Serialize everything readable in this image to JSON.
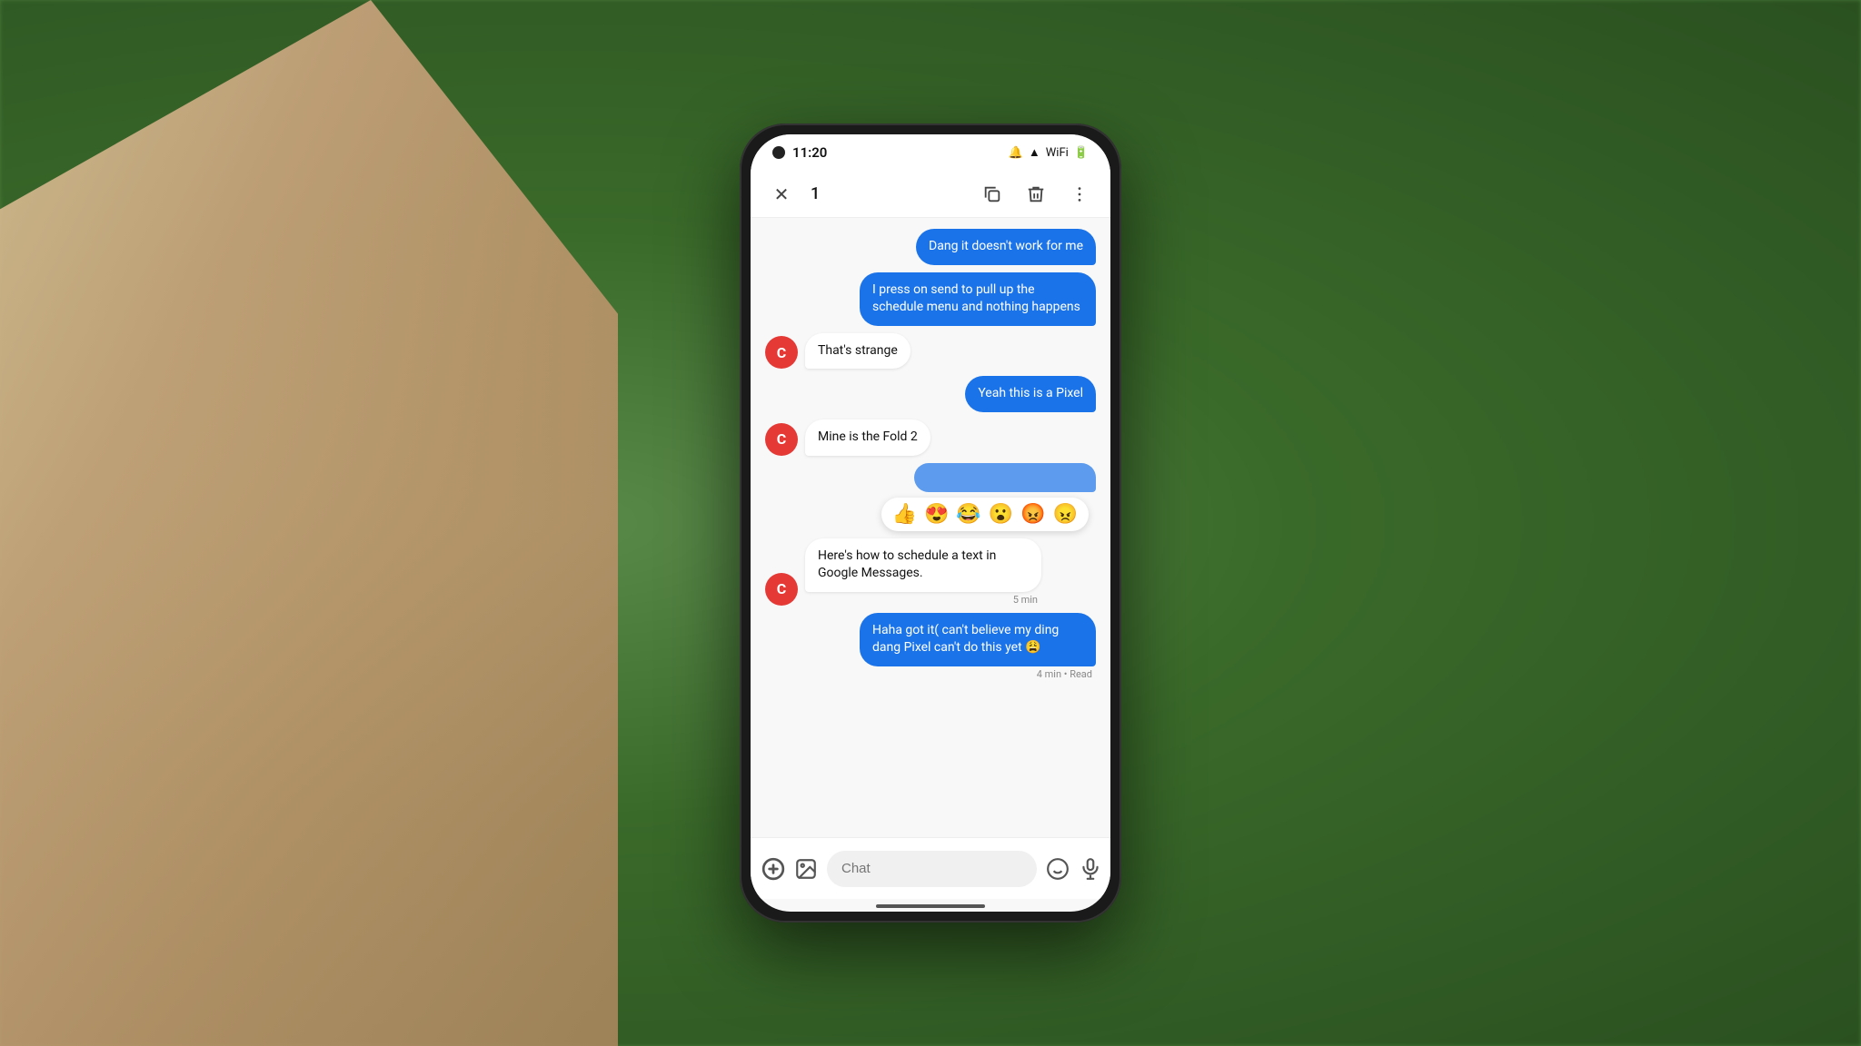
{
  "background": {
    "color": "#4a7a3a"
  },
  "status_bar": {
    "time": "11:20",
    "icons": [
      "🔕",
      "📶",
      "🔋"
    ]
  },
  "action_bar": {
    "close_label": "✕",
    "count": "1",
    "copy_icon": "⧉",
    "delete_icon": "🗑",
    "more_icon": "⋮"
  },
  "messages": [
    {
      "id": "msg1",
      "type": "sent",
      "text": "Dang it doesn't work for me",
      "timestamp": null
    },
    {
      "id": "msg2",
      "type": "sent",
      "text": "I press on send to pull up the schedule menu and nothing happens",
      "timestamp": null
    },
    {
      "id": "msg3",
      "type": "received",
      "avatar": "C",
      "text": "That's strange",
      "timestamp": null
    },
    {
      "id": "msg4",
      "type": "sent",
      "text": "Yeah this is a Pixel",
      "timestamp": null
    },
    {
      "id": "msg5",
      "type": "received",
      "avatar": "C",
      "text": "Mine is the Fold 2",
      "timestamp": null
    },
    {
      "id": "msg6",
      "type": "sent_partial",
      "text": "",
      "timestamp": null
    },
    {
      "id": "msg7",
      "type": "emoji_bar",
      "emojis": [
        "👍",
        "😍",
        "😂",
        "😮",
        "😡",
        "😠"
      ]
    },
    {
      "id": "msg8",
      "type": "received",
      "avatar": "C",
      "text": "Here's how to schedule a text in Google Messages.",
      "timestamp": "5 min"
    },
    {
      "id": "msg9",
      "type": "sent",
      "text": "Haha got it( can't believe my ding dang Pixel can't do this yet 😩",
      "timestamp": "4 min • Read"
    }
  ],
  "input_bar": {
    "add_icon": "⊕",
    "image_icon": "🖼",
    "placeholder": "Chat",
    "emoji_icon": "😊",
    "mic_icon": "🎙"
  }
}
